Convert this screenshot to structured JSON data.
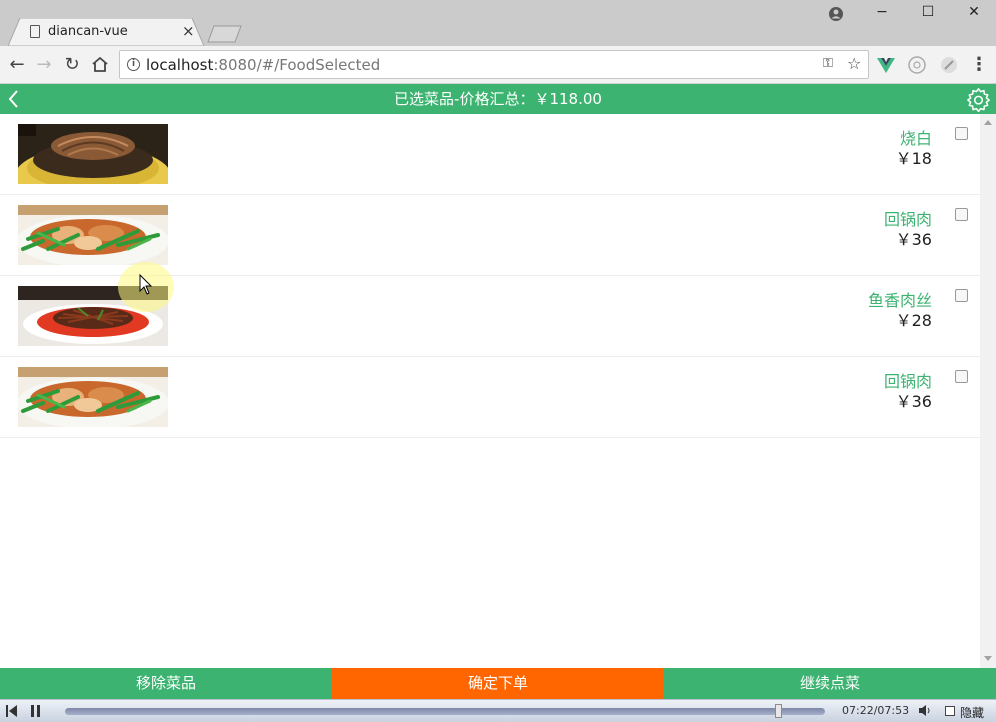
{
  "browser": {
    "tab_title": "diancan-vue",
    "tab_close": "×",
    "url_host": "localhost",
    "url_rest": ":8080/#/FoodSelected",
    "window_controls": {
      "minimize": "−",
      "maximize": "☐",
      "close": "✕"
    }
  },
  "app": {
    "header_title": "已选菜品-价格汇总：￥118.00",
    "accent_color": "#3cb371"
  },
  "items": [
    {
      "name": "烧白",
      "price": "￥18",
      "checked": false,
      "image": "shaobai-dish"
    },
    {
      "name": "回锅肉",
      "price": "￥36",
      "checked": false,
      "image": "huiguorou-dish"
    },
    {
      "name": "鱼香肉丝",
      "price": "￥28",
      "checked": false,
      "image": "yuxiang-rousi-dish"
    },
    {
      "name": "回锅肉",
      "price": "￥36",
      "checked": false,
      "image": "huiguorou-dish"
    }
  ],
  "actions": {
    "remove": "移除菜品",
    "confirm": "确定下单",
    "continue": "继续点菜",
    "confirm_color": "#ff6600"
  },
  "player": {
    "time": "07:22/07:53",
    "progress": 0.94,
    "hide_label": "隐藏"
  }
}
